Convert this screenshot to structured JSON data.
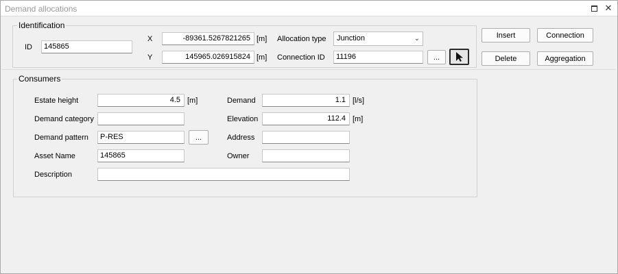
{
  "window": {
    "title": "Demand allocations",
    "controls": [
      "restore-icon",
      "close-icon"
    ],
    "close_glyph": "✕"
  },
  "identification": {
    "group_label": "Identification",
    "id_label": "ID",
    "id_value": "145865",
    "x_label": "X",
    "x_value": "-89361.5267821265",
    "y_label": "Y",
    "y_value": "145965.026915824",
    "unit_m": "[m]",
    "allocation_type_label": "Allocation type",
    "allocation_type_value": "Junction",
    "connection_id_label": "Connection ID",
    "connection_id_value": "11196",
    "browse_label": "..."
  },
  "actions": {
    "insert": "Insert",
    "connection": "Connection",
    "delete": "Delete",
    "aggregation": "Aggregation"
  },
  "consumers": {
    "group_label": "Consumers",
    "estate_height_label": "Estate height",
    "estate_height_value": "4.5",
    "estate_height_unit": "[m]",
    "demand_label": "Demand",
    "demand_value": "1.1",
    "demand_unit": "[l/s]",
    "demand_category_label": "Demand category",
    "demand_category_value": "",
    "elevation_label": "Elevation",
    "elevation_value": "112.4",
    "elevation_unit": "[m]",
    "demand_pattern_label": "Demand pattern",
    "demand_pattern_value": "P-RES",
    "pattern_browse_label": "...",
    "address_label": "Address",
    "address_value": "",
    "asset_name_label": "Asset Name",
    "asset_name_value": "145865",
    "owner_label": "Owner",
    "owner_value": "",
    "description_label": "Description",
    "description_value": ""
  }
}
